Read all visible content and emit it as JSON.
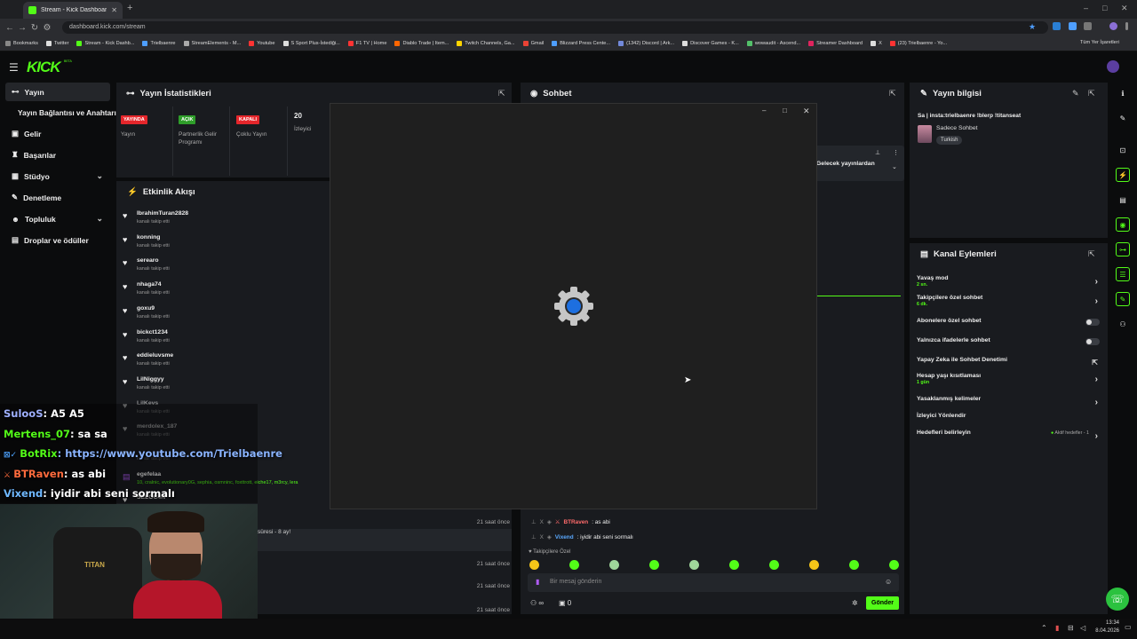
{
  "browser": {
    "tab_title": "Stream - Kick Dashboard",
    "url": "dashboard.kick.com/stream",
    "all_bookmarks": "Tüm Yer İşaretleri",
    "bookmarks": [
      {
        "label": "Bookmarks",
        "color": "#888888"
      },
      {
        "label": "Twitter",
        "color": "#dddddd"
      },
      {
        "label": "Stream - Kick Dashb...",
        "color": "#53fc18"
      },
      {
        "label": "Trielbaenre",
        "color": "#4e9eff"
      },
      {
        "label": "StreamElements - M...",
        "color": "#aaaaaa"
      },
      {
        "label": "Youtube",
        "color": "#ff3333"
      },
      {
        "label": "S Sport Plus-İstediği...",
        "color": "#dddddd"
      },
      {
        "label": "F1 TV | Home",
        "color": "#ff3333"
      },
      {
        "label": "Diablo Trade | Item...",
        "color": "#ff6600"
      },
      {
        "label": "Twitch Channels, Ga...",
        "color": "#ffd400"
      },
      {
        "label": "Gmail",
        "color": "#ea4335"
      },
      {
        "label": "Blizzard Press Cente...",
        "color": "#4e9eff"
      },
      {
        "label": "(1342) Discord | Ark...",
        "color": "#7289da"
      },
      {
        "label": "Discover Games - K...",
        "color": "#dddddd"
      },
      {
        "label": "wowaudit - Ascend...",
        "color": "#53c06a"
      },
      {
        "label": "Streamer Dashboard",
        "color": "#e0245e"
      },
      {
        "label": "X",
        "color": "#dddddd"
      },
      {
        "label": "(23) Trielbaenre - Yo...",
        "color": "#ff3333"
      }
    ]
  },
  "brand": {
    "logo": "KICK",
    "logo_sup": "BETA"
  },
  "sidebar": {
    "items": [
      {
        "label": "Yayın",
        "icon": "broadcast-icon"
      },
      {
        "label": "Yayın Bağlantısı ve Anahtarı"
      },
      {
        "label": "Gelir",
        "icon": "wallet-icon"
      },
      {
        "label": "Başarılar",
        "icon": "trophy-icon"
      },
      {
        "label": "Stüdyo",
        "icon": "grid-icon"
      },
      {
        "label": "Denetleme",
        "icon": "wrench-icon"
      },
      {
        "label": "Topluluk",
        "icon": "users-icon"
      },
      {
        "label": "Droplar ve ödüller",
        "icon": "gift-icon"
      }
    ]
  },
  "stats": {
    "title": "Yayın İstatistikleri",
    "items": [
      {
        "badge": "YAYINDA",
        "badge_color": "#e5262b",
        "label": "Yayın"
      },
      {
        "badge": "AÇIK",
        "badge_color": "#2f9e2a",
        "label": "Partnerlik Gelir Programı"
      },
      {
        "badge": "KAPALI",
        "badge_color": "#e5262b",
        "label": "Çoklu Yayın"
      },
      {
        "badge": "20",
        "label": "İzleyici"
      }
    ]
  },
  "activity": {
    "title": "Etkinlik Akışı",
    "events": [
      {
        "name": "IbrahimTuran2828",
        "sub": "kanalı takip etti"
      },
      {
        "name": "konning",
        "sub": "kanalı takip etti"
      },
      {
        "name": "serearo",
        "sub": "kanalı takip etti"
      },
      {
        "name": "nhaga74",
        "sub": "kanalı takip etti"
      },
      {
        "name": "goxu9",
        "sub": "kanalı takip etti"
      },
      {
        "name": "bickct1234",
        "sub": "kanalı takip etti"
      },
      {
        "name": "eddieluvsme",
        "sub": "kanalı takip etti"
      },
      {
        "name": "LilNiggyy",
        "sub": "kanalı takip etti"
      },
      {
        "name": "LilKevs",
        "sub": "kanalı takip etti"
      },
      {
        "name": "merdolex_187",
        "sub": "kanalı takip etti"
      },
      {
        "name": "",
        "sub": "kanalı takip etti"
      },
      {
        "name": "egefelaa",
        "sub": "10, cralnic, evolutionary0G, sephia, osmninc, foxttrott, eiche17, m3rcy, lera"
      },
      {
        "name": "SELOC4N",
        "sub": ""
      }
    ],
    "lower_rows": [
      {
        "text": "",
        "time": "21 saat önce"
      },
      {
        "text": "süresi - 8 ay!",
        "time": ""
      },
      {
        "text": "",
        "time": "21 saat önce"
      },
      {
        "text": "",
        "time": "21 saat önce"
      },
      {
        "text": "",
        "time": "21 saat önce"
      }
    ]
  },
  "chat": {
    "title": "Sohbet",
    "pinned_text": "Gelecek yayınlardan",
    "messages": [
      {
        "user": "BTRaven",
        "text": ": as abi",
        "color": "#ff6b6b"
      },
      {
        "user": "Vixend",
        "text": ": iyidir abi seni sormalı",
        "color": "#5aa9ff"
      }
    ],
    "mode_label": "Takipçilere Özel",
    "input_placeholder": "Bir mesaj gönderin",
    "infinity": "∞",
    "counter": "0",
    "send_button": "Gönder"
  },
  "stream_info": {
    "title": "Yayın bilgisi",
    "stream_title": "Sa | insta:trielbaenre !blerp !titanseat",
    "category": "Sadece Sohbet",
    "tag": "Turkish"
  },
  "channel_actions": {
    "title": "Kanal Eylemleri",
    "items": [
      {
        "label": "Yavaş mod",
        "sub": "2 sn.",
        "control": "arrow"
      },
      {
        "label": "Takipçilere özel sohbet",
        "sub": "6 dk.",
        "control": "arrow"
      },
      {
        "label": "Abonelere özel sohbet",
        "sub": "",
        "control": "toggle"
      },
      {
        "label": "Yalnızca ifadelerle sohbet",
        "sub": "",
        "control": "toggle"
      },
      {
        "label": "Yapay Zeka ile Sohbet Denetimi",
        "sub": "",
        "control": "external"
      },
      {
        "label": "Hesap yaşı kısıtlaması",
        "sub": "1 gün",
        "control": "arrow"
      },
      {
        "label": "Yasaklanmış kelimeler",
        "sub": "",
        "control": "arrow"
      },
      {
        "label": "İzleyici Yönlendir",
        "sub": "",
        "control": "none"
      },
      {
        "label": "Hedefleri belirleyin",
        "sub": "",
        "control": "arrow",
        "extra": "Aktif hedefler - 1"
      }
    ]
  },
  "overlay_chat": [
    {
      "user": "SulooS",
      "text": ": A5 A5",
      "color": "#9fb0ff"
    },
    {
      "user": "Mertens_07",
      "text": ": sa sa",
      "color": "#53fc18"
    },
    {
      "user": "BotRix",
      "text": ": https://www.youtube.com/Trielbaenre",
      "color": "#53fc18",
      "link": true
    },
    {
      "user": "BTRaven",
      "text": ": as abi",
      "color": "#ff6b3d"
    },
    {
      "user": "Vixend",
      "text": ": iyidir abi seni sormalı",
      "color": "#6fb8ff"
    }
  ],
  "taskbar": {
    "time": "13:34",
    "date": "8.04.2026"
  }
}
